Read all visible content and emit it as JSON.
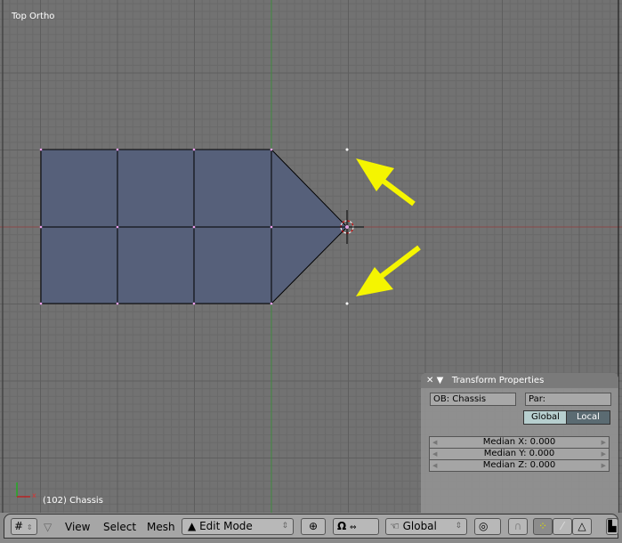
{
  "viewport": {
    "view_label": "Top Ortho",
    "object_info": "(102) Chassis",
    "mesh_color": "#56607a",
    "arrow_color": "#f5f500"
  },
  "transform_panel": {
    "title": "Transform Properties",
    "object_field": "OB: Chassis",
    "parent_field": "Par:",
    "global_label": "Global",
    "local_label": "Local",
    "median_x": "Median X: 0.000",
    "median_y": "Median Y: 0.000",
    "median_z": "Median Z: 0.000"
  },
  "header": {
    "menus": [
      "View",
      "Select",
      "Mesh"
    ],
    "mode": "Edit Mode",
    "orientation": "Global"
  }
}
